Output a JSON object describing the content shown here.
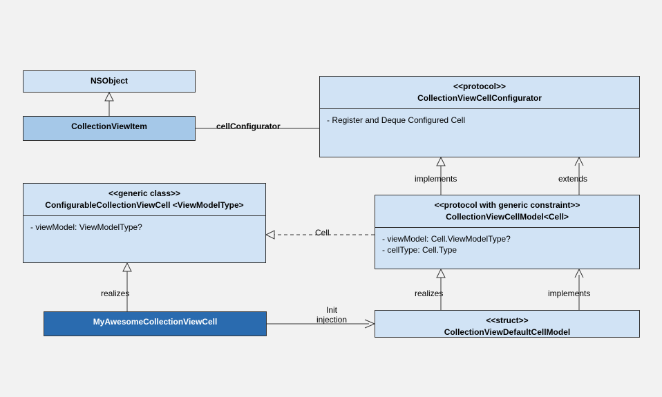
{
  "diagram": {
    "nsobject": {
      "title": "NSObject"
    },
    "collectionViewItem": {
      "title": "CollectionViewItem"
    },
    "configurator": {
      "stereo": "<<protocol>>",
      "title": "CollectionViewCellConfigurator",
      "body": "- Register and Deque Configured Cell"
    },
    "configurableCell": {
      "stereo": "<<generic class>>",
      "title": "ConfigurableCollectionViewCell <ViewModelType>",
      "body": "- viewModel: ViewModelType?"
    },
    "cellModel": {
      "stereo": "<<protocol with generic constraint>>",
      "title": "CollectionViewCellModel<Cell>",
      "body1": "- viewModel: Cell.ViewModelType?",
      "body2": "- cellType: Cell.Type"
    },
    "myAwesome": {
      "title": "MyAwesomeCollectionViewCell"
    },
    "defaultModel": {
      "stereo": "<<struct>>",
      "title": "CollectionViewDefaultCellModel"
    },
    "labels": {
      "cellConfigurator": "cellConfigurator",
      "implements1": "implements",
      "extends": "extends",
      "cell": "Cell",
      "realizes1": "realizes",
      "realizes2": "realizes",
      "implements2": "implements",
      "initInjection1": "Init",
      "initInjection2": "injection"
    }
  }
}
